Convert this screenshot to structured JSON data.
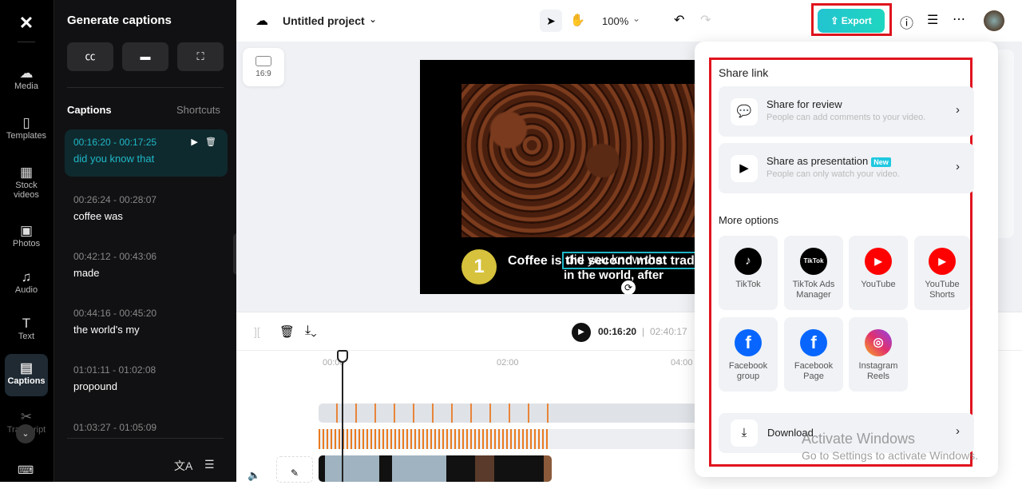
{
  "rail": {
    "items": [
      {
        "label": "Media",
        "icon": "cloud-upload-icon"
      },
      {
        "label": "Templates",
        "icon": "templates-icon"
      },
      {
        "label": "Stock videos",
        "icon": "film-icon"
      },
      {
        "label": "Photos",
        "icon": "image-icon"
      },
      {
        "label": "Audio",
        "icon": "music-icon"
      },
      {
        "label": "Text",
        "icon": "text-icon"
      },
      {
        "label": "Captions",
        "icon": "captions-icon",
        "selected": true
      },
      {
        "label": "Transcript",
        "icon": "transcript-icon"
      }
    ]
  },
  "panel": {
    "title": "Generate captions",
    "captions_label": "Captions",
    "shortcuts_label": "Shortcuts",
    "captions": [
      {
        "time": "00:16:20 - 00:17:25",
        "text": "did you know that"
      },
      {
        "time": "00:26:24 - 00:28:07",
        "text": "coffee was"
      },
      {
        "time": "00:42:12 - 00:43:06",
        "text": "made"
      },
      {
        "time": "00:44:16 - 00:45:20",
        "text": "the world's my"
      },
      {
        "time": "01:01:11 - 01:02:08",
        "text": "propound"
      },
      {
        "time": "01:03:27 - 01:05:09",
        "text": ""
      }
    ]
  },
  "topbar": {
    "project_name": "Untitled project",
    "zoom": "100%",
    "export_label": "Export",
    "accent": "#1ec8c8"
  },
  "canvas": {
    "ratio": "16:9",
    "number_badge": "1",
    "subtitle_line1": "Coffee is the second most trad",
    "subtitle_line2": "in the world, after",
    "selected_caption": "did you know that"
  },
  "timeline": {
    "current_time": "00:16:20",
    "total_time": "02:40:17",
    "ruler": [
      "00:00",
      "02:00",
      "04:00"
    ]
  },
  "export_popup": {
    "share_link_label": "Share link",
    "share_options": [
      {
        "title": "Share for review",
        "desc": "People can add comments to your video."
      },
      {
        "title": "Share as presentation",
        "badge": "New",
        "desc": "People can only watch your video."
      }
    ],
    "more_options_label": "More options",
    "platforms": [
      {
        "label": "TikTok",
        "color": "#000000"
      },
      {
        "label": "TikTok Ads Manager",
        "color": "#000000"
      },
      {
        "label": "YouTube",
        "color": "#ff0000"
      },
      {
        "label": "YouTube Shorts",
        "color": "#ff0000"
      },
      {
        "label": "Facebook group",
        "color": "#0866ff"
      },
      {
        "label": "Facebook Page",
        "color": "#0866ff"
      },
      {
        "label": "Instagram Reels",
        "color": "#e1306c"
      }
    ],
    "download_label": "Download"
  },
  "watermark": {
    "line1": "Activate Windows",
    "line2": "Go to Settings to activate Windows."
  }
}
